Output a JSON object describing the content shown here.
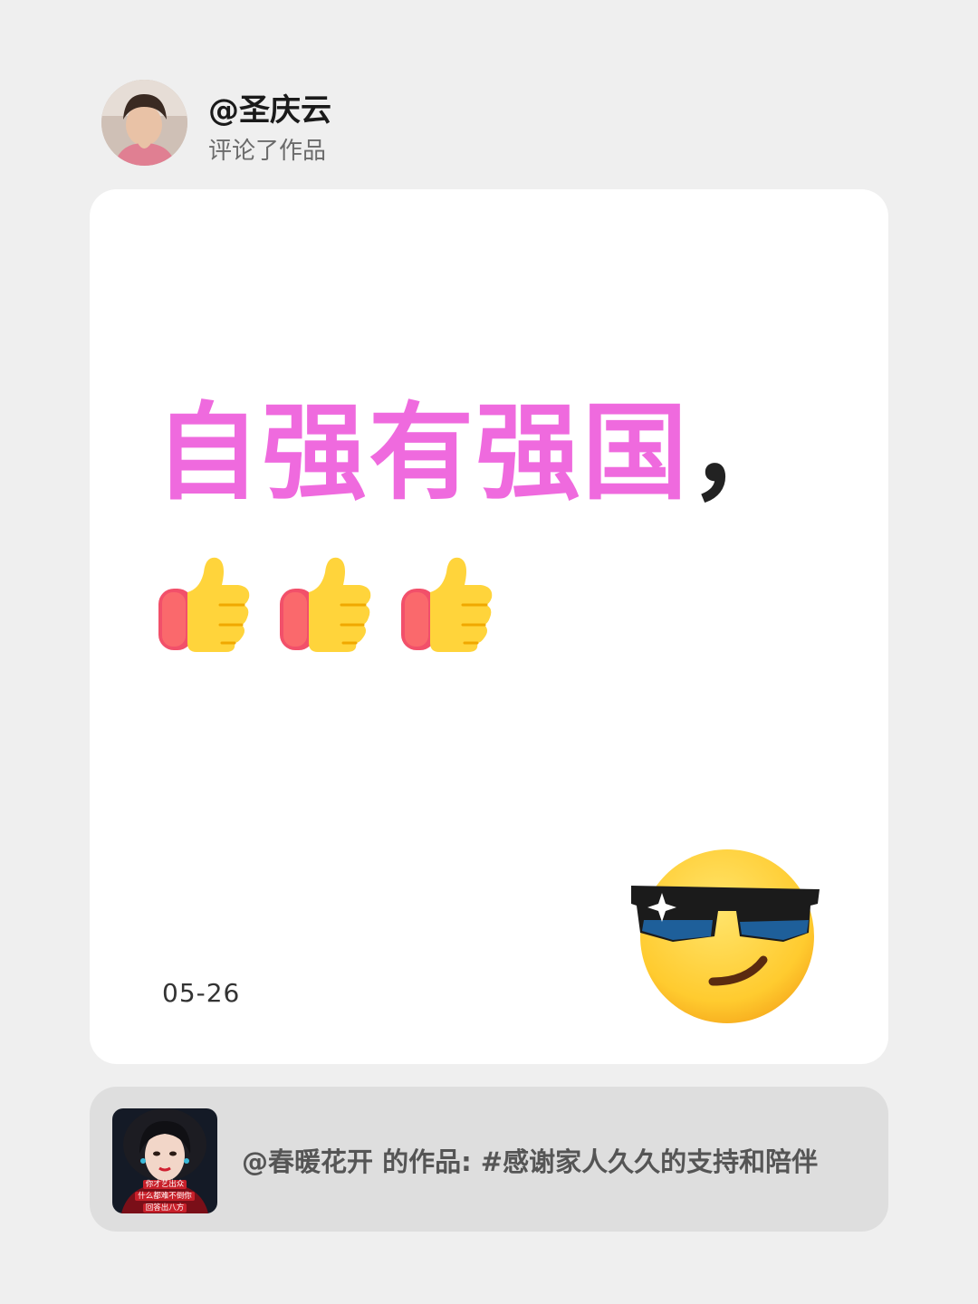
{
  "header": {
    "username": "@圣庆云",
    "action": "评论了作品"
  },
  "comment": {
    "text_pink": "自强有强国",
    "text_punct": "，",
    "emojis": [
      "thumbs-up-icon",
      "thumbs-up-icon",
      "thumbs-up-icon"
    ],
    "sticker": "cool-sunglasses-emoji",
    "date": "05-26"
  },
  "work": {
    "title": "@春暖花开 的作品: #感谢家人久久的支持和陪伴",
    "thumbnail_caption": [
      "你才艺出众",
      "什么都难不倒你",
      "回答出八方"
    ]
  },
  "colors": {
    "background": "#efefef",
    "card": "#ffffff",
    "work_card": "#dedede",
    "comment_accent": "#ef6ade"
  }
}
